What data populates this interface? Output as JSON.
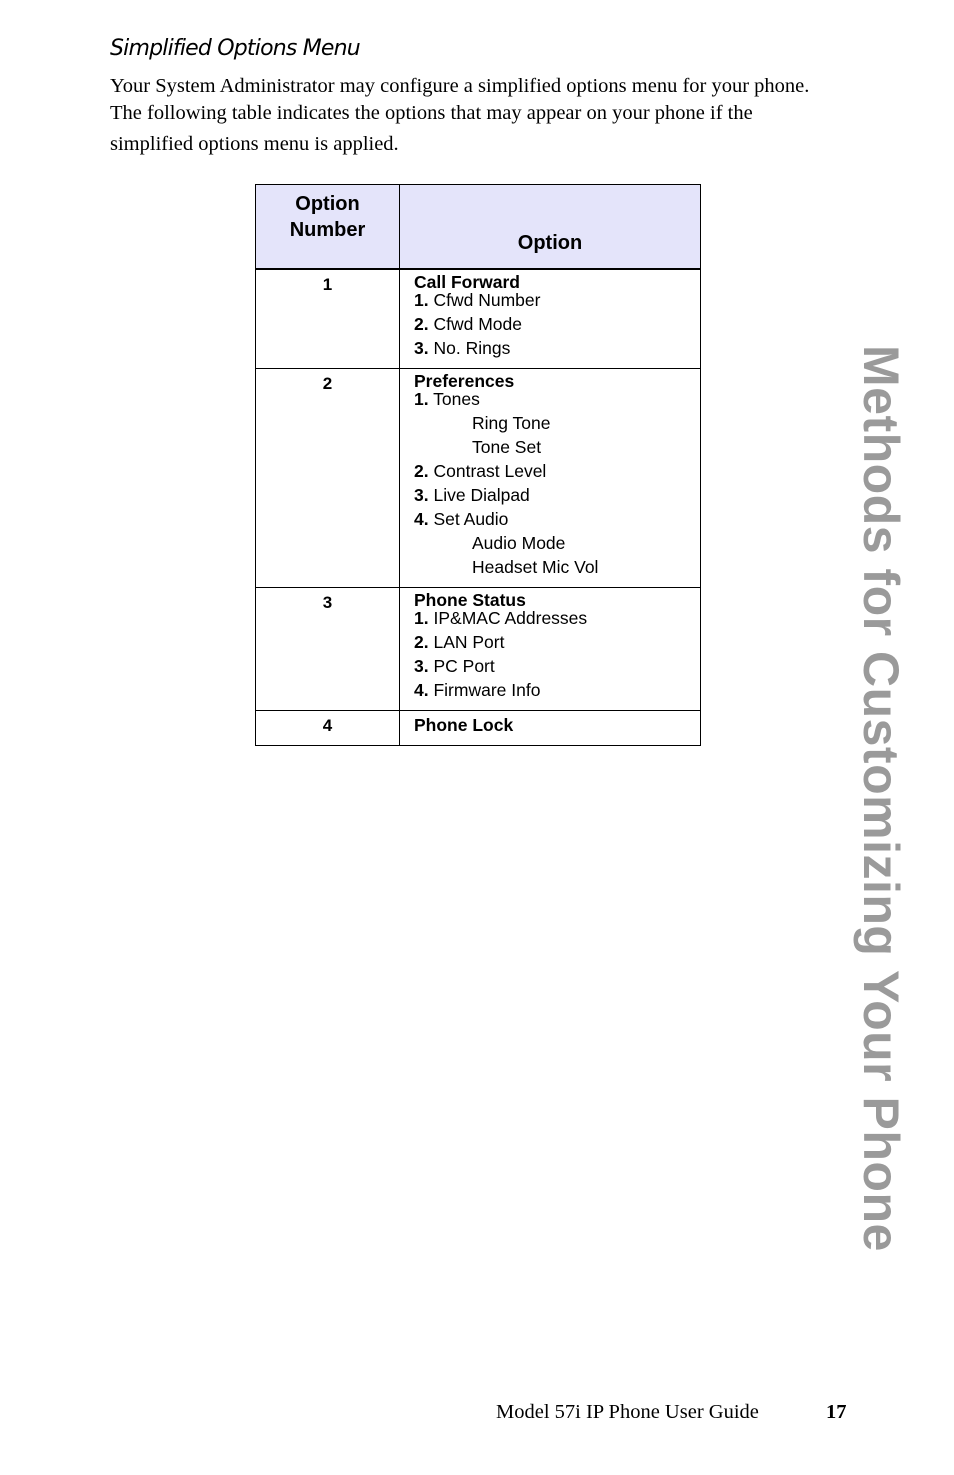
{
  "section_title": "Simplified Options Menu",
  "intro": {
    "line1": "Your System Administrator may configure a simplified options menu for your phone.",
    "line2": "The following table indicates the options that may appear on your phone if the",
    "line3": "simplified options menu is applied."
  },
  "table": {
    "headers": {
      "number_line1": "Option",
      "number_line2": "Number",
      "option": "Option"
    },
    "rows": [
      {
        "number": "1",
        "group": "Call Forward",
        "items": [
          {
            "num": "1.",
            "label": "Cfwd Number",
            "subs": []
          },
          {
            "num": "2.",
            "label": "Cfwd Mode",
            "subs": []
          },
          {
            "num": "3.",
            "label": "No. Rings",
            "subs": []
          }
        ]
      },
      {
        "number": "2",
        "group": "Preferences",
        "items": [
          {
            "num": "1.",
            "label": "Tones",
            "subs": [
              "Ring Tone",
              "Tone Set"
            ]
          },
          {
            "num": "2.",
            "label": "Contrast Level",
            "subs": []
          },
          {
            "num": "3.",
            "label": "Live Dialpad",
            "subs": []
          },
          {
            "num": "4.",
            "label": "Set Audio",
            "subs": [
              "Audio Mode",
              "Headset Mic Vol"
            ]
          }
        ]
      },
      {
        "number": "3",
        "group": "Phone Status",
        "items": [
          {
            "num": "1.",
            "label": "IP&MAC Addresses",
            "subs": []
          },
          {
            "num": "2.",
            "label": "LAN Port",
            "subs": []
          },
          {
            "num": "3.",
            "label": "PC Port",
            "subs": []
          },
          {
            "num": "4.",
            "label": "Firmware Info",
            "subs": []
          }
        ]
      },
      {
        "number": "4",
        "group": "Phone Lock",
        "items": []
      }
    ]
  },
  "side_tab": "Methods for Customizing Your Phone",
  "footer": {
    "guide_title": "Model 57i IP Phone User Guide",
    "page_number": "17"
  },
  "colors": {
    "header_fill": "#e4e4fa",
    "side_tab_text": "#9a9a9a"
  }
}
